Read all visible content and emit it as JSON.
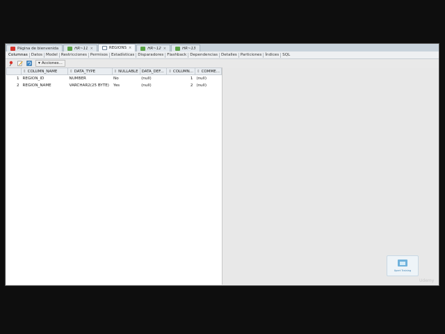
{
  "doc_tabs": [
    {
      "label": "Página de bienvenida",
      "icon": "welcome-icon",
      "style": "normal"
    },
    {
      "label": "HR~11",
      "icon": "sql-worksheet-icon",
      "style": "italic"
    },
    {
      "label": "REGIONS",
      "icon": "table-icon",
      "style": "active"
    },
    {
      "label": "HR~12",
      "icon": "sql-worksheet-icon",
      "style": "italic"
    },
    {
      "label": "HR~13",
      "icon": "sql-worksheet-icon",
      "style": "italic"
    }
  ],
  "sub_tabs": [
    "Columnas",
    "Datos",
    "Model",
    "Restricciones",
    "Permisos",
    "Estadísticas",
    "Disparadores",
    "Flashback",
    "Dependencias",
    "Detalles",
    "Particiones",
    "Índices",
    "SQL"
  ],
  "toolbar": {
    "actions_label": "Acciones..."
  },
  "columns_table": {
    "headers": [
      "COLUMN_NAME",
      "DATA_TYPE",
      "NULLABLE",
      "DATA_DEF...",
      "COLUMN...",
      "COMME..."
    ],
    "rows": [
      {
        "row_num": "1",
        "column_name": "REGION_ID",
        "data_type": "NUMBER",
        "nullable": "No",
        "data_default": "(null)",
        "column_id": "1",
        "comments": "(null)"
      },
      {
        "row_num": "2",
        "column_name": "REGION_NAME",
        "data_type": "VARCHAR2(25 BYTE)",
        "nullable": "Yes",
        "data_default": "(null)",
        "column_id": "2",
        "comments": "(null)"
      }
    ]
  },
  "watermark": {
    "text": "Xpert Training"
  },
  "branding": {
    "udemy": "Udemy"
  },
  "colors": {
    "tab_bar": "#c9d3dc",
    "grid_bg": "#ffffff",
    "panel_bg": "#e8e8e8",
    "tab_close_red": "#d4342c",
    "worksheet_green": "#5aa346"
  }
}
